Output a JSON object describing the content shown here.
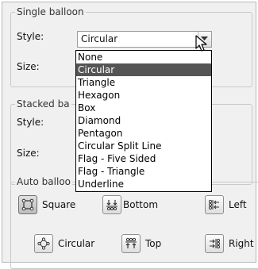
{
  "single_balloon": {
    "legend": "Single balloon",
    "style_label": "Style:",
    "style_value": "Circular",
    "size_label": "Size:"
  },
  "stacked_balloons": {
    "legend": "Stacked ba",
    "style_label": "Style:",
    "size_label": "Size:"
  },
  "style_dropdown": {
    "options": [
      "None",
      "Circular",
      "Triangle",
      "Hexagon",
      "Box",
      "Diamond",
      "Pentagon",
      "Circular Split Line",
      "Flag - Five Sided",
      "Flag - Triangle",
      "Underline"
    ],
    "selected": "Circular",
    "selected_color": "#555555"
  },
  "auto_balloon": {
    "legend": "Auto balloo",
    "buttons": [
      {
        "label": "Square",
        "icon": "square-layout-icon",
        "active": true
      },
      {
        "label": "Bottom",
        "icon": "bottom-align-icon",
        "active": false
      },
      {
        "label": "Left",
        "icon": "left-align-icon",
        "active": false
      },
      {
        "label": "Circular",
        "icon": "circular-layout-icon",
        "active": false
      },
      {
        "label": "Top",
        "icon": "top-align-icon",
        "active": false
      },
      {
        "label": "Right",
        "icon": "right-align-icon",
        "active": false
      }
    ]
  }
}
